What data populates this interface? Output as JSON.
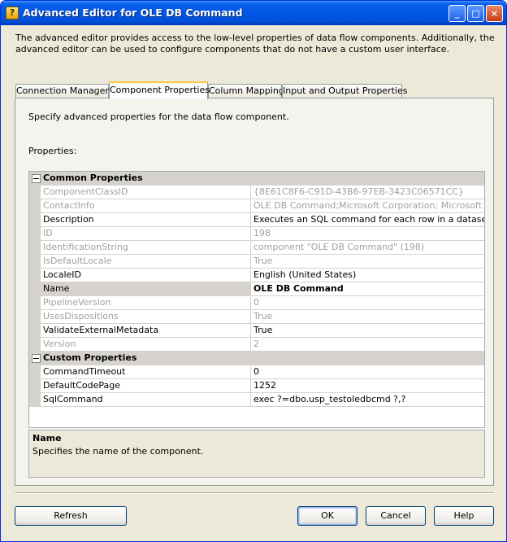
{
  "window": {
    "title": "Advanced Editor for OLE DB Command",
    "icon": "ssis-component-icon",
    "controls": {
      "minimize": "_",
      "maximize": "□",
      "close": "×"
    }
  },
  "description": "The advanced editor provides access to the low-level properties of data flow components. Additionally, the advanced editor can be used to configure components that do not have a custom user interface.",
  "tabs": [
    {
      "label": "Connection Managers",
      "active": false
    },
    {
      "label": "Component Properties",
      "active": true
    },
    {
      "label": "Column Mappings",
      "active": false
    },
    {
      "label": "Input and Output Properties",
      "active": false
    }
  ],
  "panel": {
    "intro": "Specify advanced properties for the data flow component.",
    "properties_label": "Properties:"
  },
  "grid": {
    "categories": [
      {
        "name": "Common Properties",
        "expanded": true,
        "rows": [
          {
            "name": "ComponentClassID",
            "value": "{8E61C8F6-C91D-43B6-97EB-3423C06571CC}",
            "readonly": true
          },
          {
            "name": "ContactInfo",
            "value": "OLE DB Command;Microsoft Corporation; Microsoft SqlServer",
            "readonly": true
          },
          {
            "name": "Description",
            "value": "Executes an SQL command for each row in a dataset.",
            "readonly": false
          },
          {
            "name": "ID",
            "value": "198",
            "readonly": true
          },
          {
            "name": "IdentificationString",
            "value": "component \"OLE DB Command\" (198)",
            "readonly": true
          },
          {
            "name": "IsDefaultLocale",
            "value": "True",
            "readonly": true
          },
          {
            "name": "LocaleID",
            "value": "English (United States)",
            "readonly": false
          },
          {
            "name": "Name",
            "value": "OLE DB Command",
            "readonly": false,
            "selected": true
          },
          {
            "name": "PipelineVersion",
            "value": "0",
            "readonly": true
          },
          {
            "name": "UsesDispositions",
            "value": "True",
            "readonly": true
          },
          {
            "name": "ValidateExternalMetadata",
            "value": "True",
            "readonly": false
          },
          {
            "name": "Version",
            "value": "2",
            "readonly": true
          }
        ]
      },
      {
        "name": "Custom Properties",
        "expanded": true,
        "rows": [
          {
            "name": "CommandTimeout",
            "value": "0",
            "readonly": false
          },
          {
            "name": "DefaultCodePage",
            "value": "1252",
            "readonly": false
          },
          {
            "name": "SqlCommand",
            "value": "exec ?=dbo.usp_testoledbcmd ?,?",
            "readonly": false
          }
        ]
      }
    ]
  },
  "help": {
    "title": "Name",
    "text": "Specifies the name of the component."
  },
  "buttons": {
    "refresh": "Refresh",
    "ok": "OK",
    "cancel": "Cancel",
    "help": "Help"
  }
}
